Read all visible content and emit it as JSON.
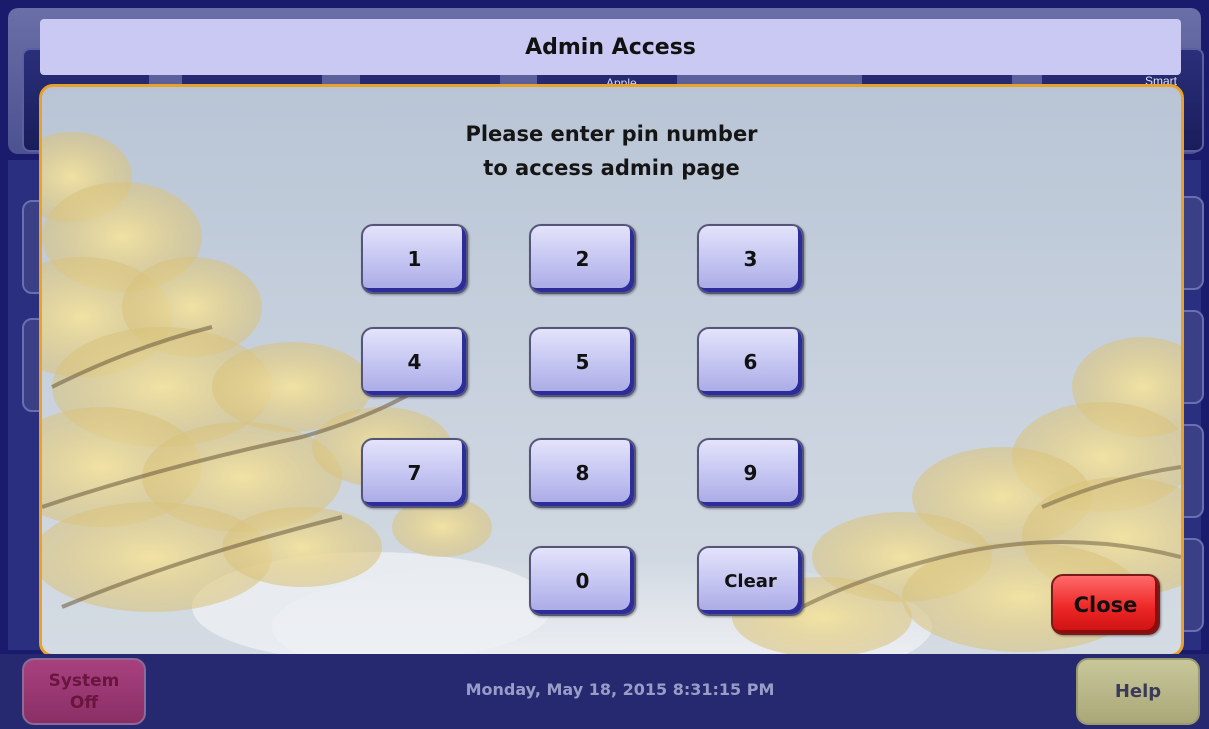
{
  "dialog": {
    "title": "Admin Access",
    "instruction_line1": "Please enter pin number",
    "instruction_line2": "to access admin page"
  },
  "keypad": {
    "keys": [
      "1",
      "2",
      "3",
      "4",
      "5",
      "6",
      "7",
      "8",
      "9",
      "0"
    ],
    "clear_label": "Clear"
  },
  "close_label": "Close",
  "background": {
    "apple_label": "Apple",
    "smart_label": "Smart"
  },
  "footer": {
    "system_line1": "System",
    "system_line2": "Off",
    "datetime": "Monday, May 18, 2015 8:31:15 PM",
    "help_label": "Help"
  },
  "colors": {
    "modal_border": "#e8a12a",
    "key_face": "#c3c3f1",
    "close_red": "#ee2727",
    "title_bar": "#c9c9f3",
    "background_navy": "#1b1b6e"
  }
}
